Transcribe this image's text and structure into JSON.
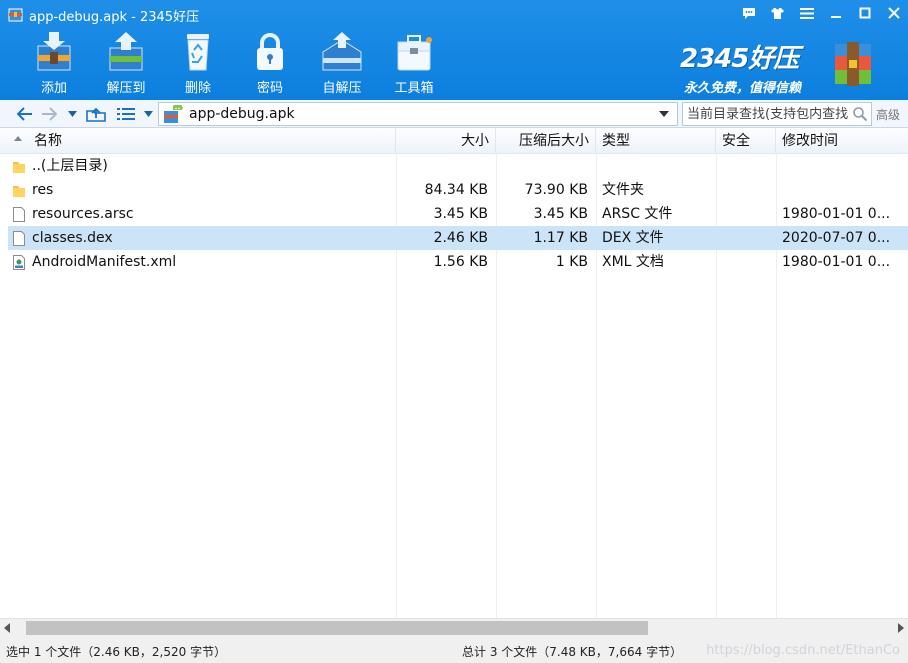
{
  "window": {
    "title": "app-debug.apk - 2345好压",
    "controls": [
      "feedback-icon",
      "skin-icon",
      "menu-icon",
      "minimize-icon",
      "maximize-icon",
      "close-icon"
    ]
  },
  "toolbar": {
    "items": [
      {
        "label": "添加",
        "icon": "add-archive-icon"
      },
      {
        "label": "解压到",
        "icon": "extract-to-icon"
      },
      {
        "label": "删除",
        "icon": "recycle-bin-icon"
      },
      {
        "label": "密码",
        "icon": "lock-icon"
      },
      {
        "label": "自解压",
        "icon": "self-extract-icon"
      },
      {
        "label": "工具箱",
        "icon": "toolbox-icon"
      }
    ]
  },
  "brand": {
    "name": "2345好压",
    "slogan": "永久免费，值得信赖"
  },
  "address": {
    "path": "app-debug.apk",
    "search_placeholder": "当前目录查找(支持包内查找)",
    "advanced_label": "高级"
  },
  "columns": {
    "name": "名称",
    "size": "大小",
    "packed": "压缩后大小",
    "type": "类型",
    "security": "安全",
    "modified": "修改时间"
  },
  "files": [
    {
      "name": "..(上层目录)",
      "size": "",
      "packed": "",
      "type": "",
      "security": "",
      "modified": "",
      "icon": "folder-icon",
      "selected": false
    },
    {
      "name": "res",
      "size": "84.34 KB",
      "packed": "73.90 KB",
      "type": "文件夹",
      "security": "",
      "modified": "",
      "icon": "folder-icon",
      "selected": false
    },
    {
      "name": "resources.arsc",
      "size": "3.45 KB",
      "packed": "3.45 KB",
      "type": "ARSC 文件",
      "security": "",
      "modified": "1980-01-01 0...",
      "icon": "file-icon",
      "selected": false
    },
    {
      "name": "classes.dex",
      "size": "2.46 KB",
      "packed": "1.17 KB",
      "type": "DEX 文件",
      "security": "",
      "modified": "2020-07-07 0...",
      "icon": "file-icon",
      "selected": true
    },
    {
      "name": "AndroidManifest.xml",
      "size": "1.56 KB",
      "packed": "1 KB",
      "type": "XML 文档",
      "security": "",
      "modified": "1980-01-01 0...",
      "icon": "xml-file-icon",
      "selected": false
    }
  ],
  "status": {
    "selection": "选中 1 个文件（2.46 KB，2,520 字节）",
    "total": "总计 3 个文件（7.48 KB，7,664 字节）",
    "watermark": "https://blog.csdn.net/EthanCo"
  },
  "colors": {
    "toolbar_blue": "#0c7fde",
    "selected_row": "#cce4f7"
  }
}
